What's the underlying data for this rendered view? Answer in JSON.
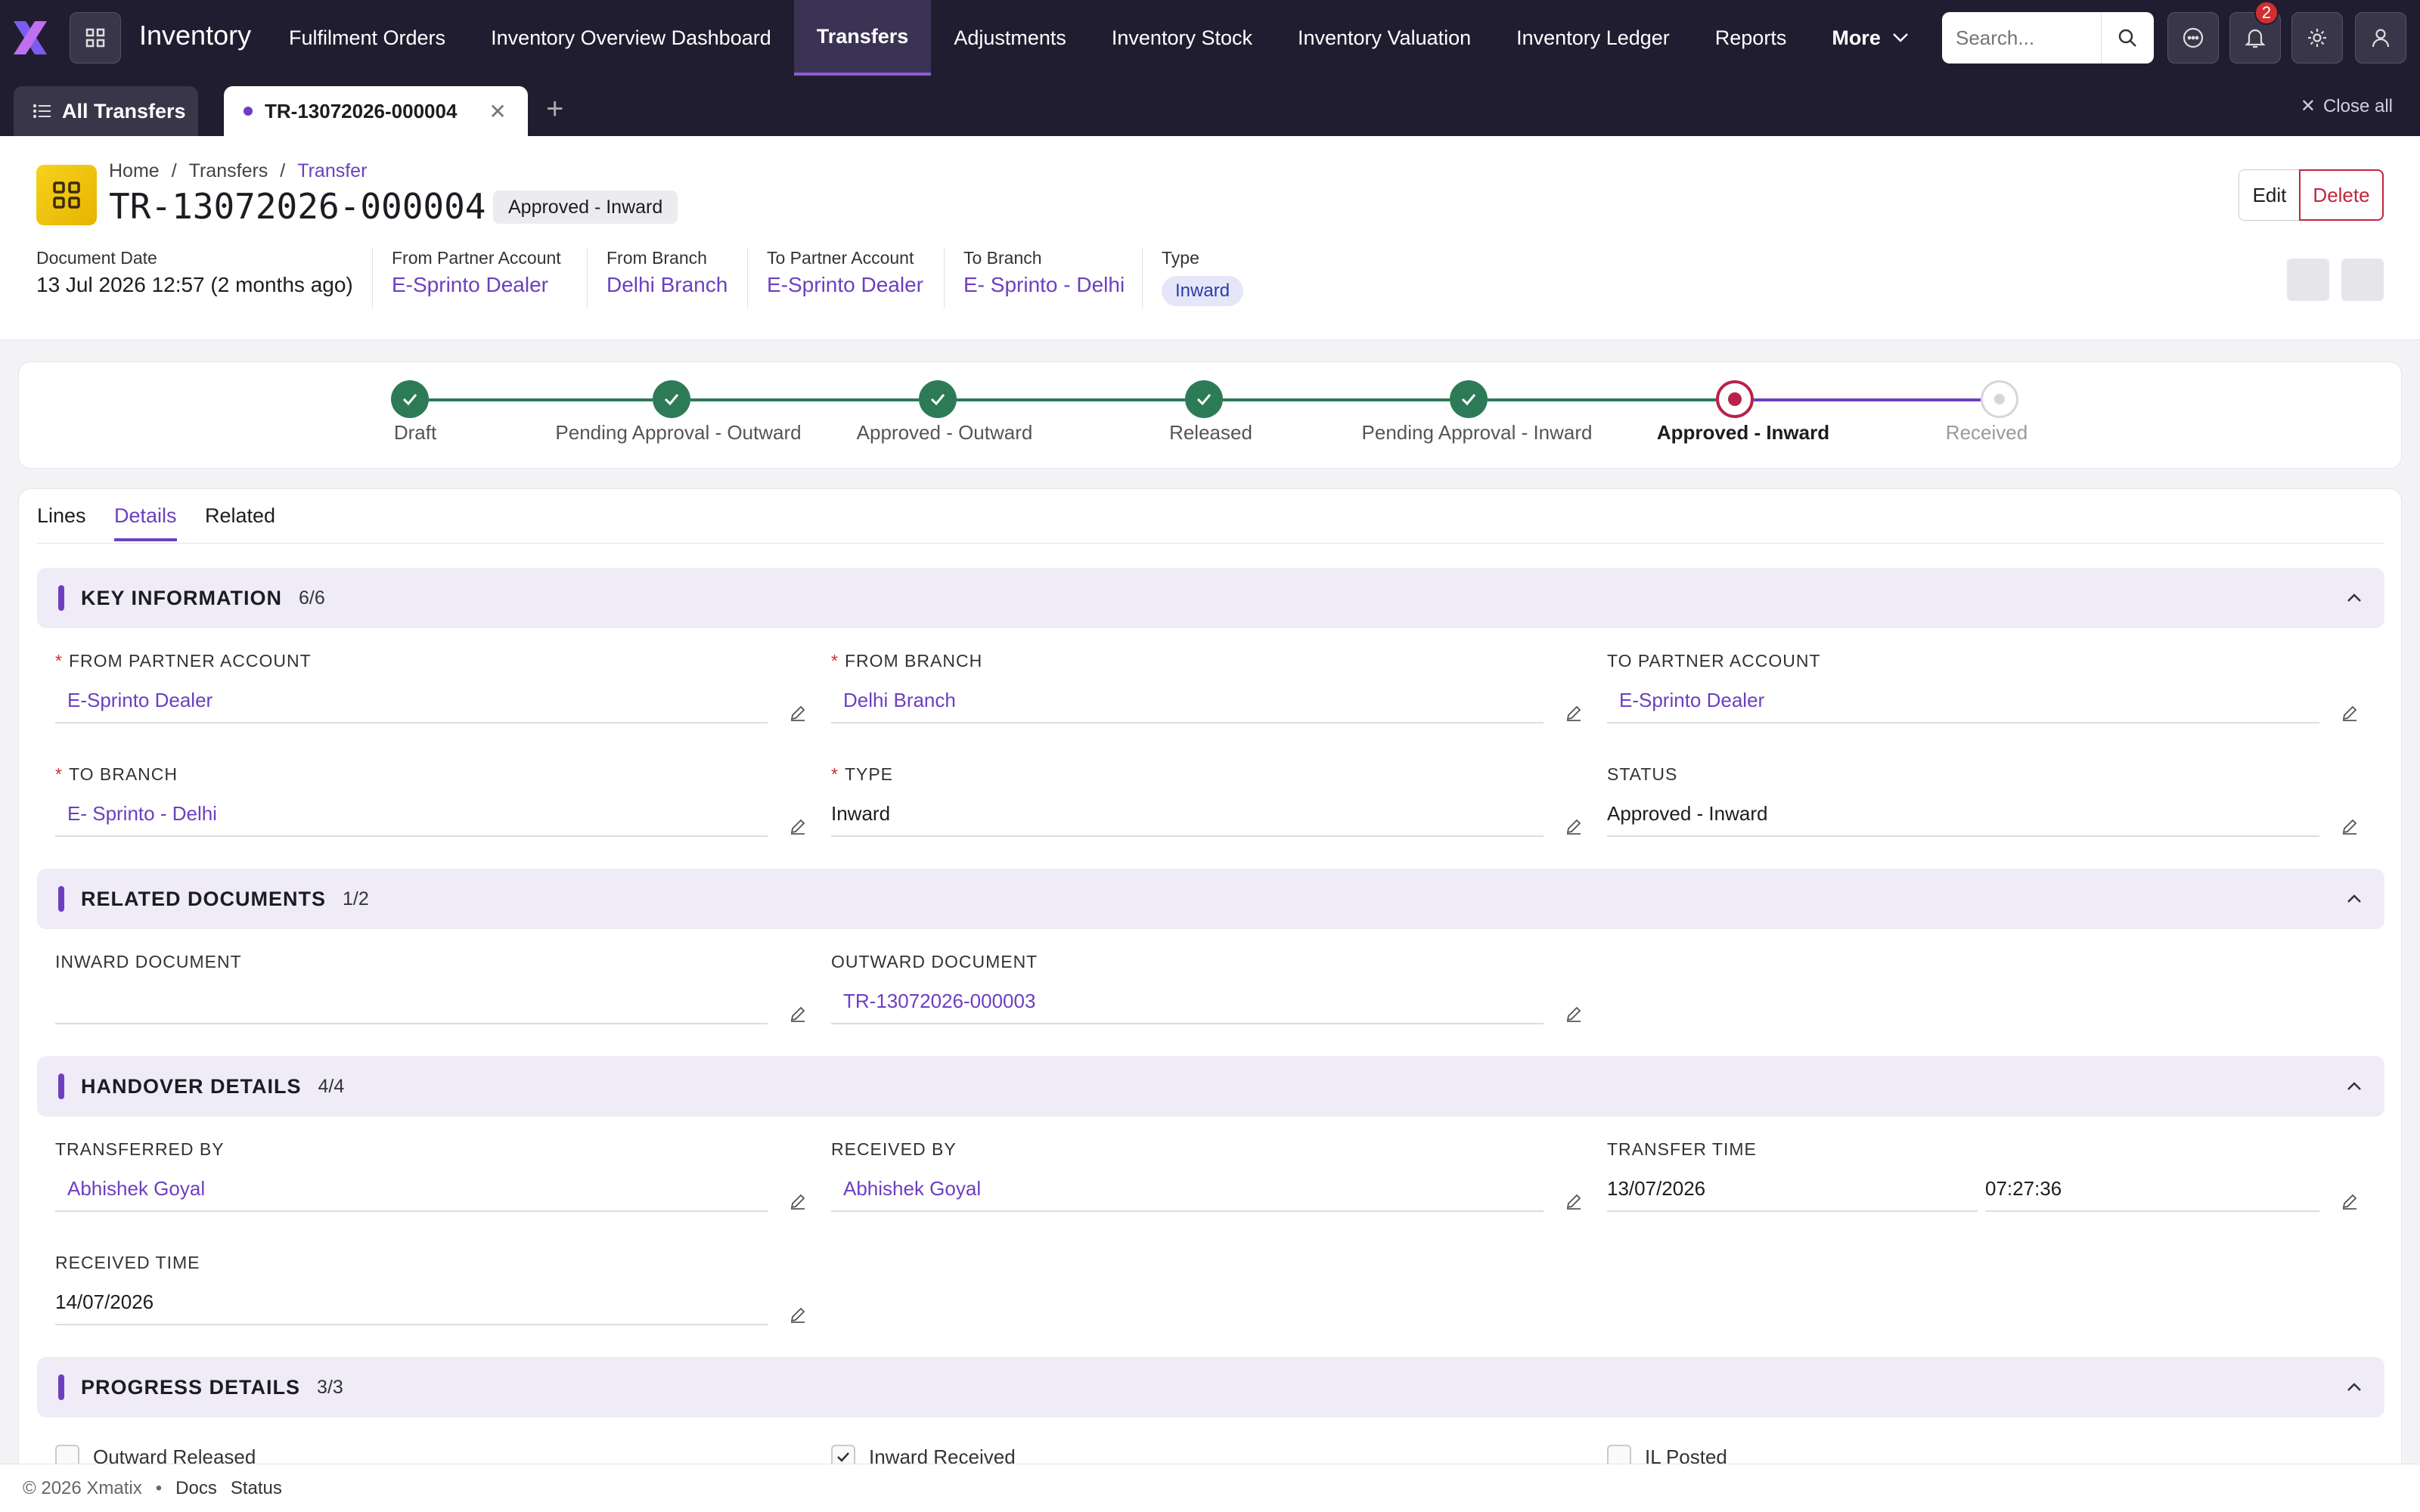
{
  "app": {
    "name": "Inventory"
  },
  "nav": [
    "Fulfilment Orders",
    "Inventory Overview Dashboard",
    "Transfers",
    "Adjustments",
    "Inventory Stock",
    "Inventory Valuation",
    "Inventory Ledger",
    "Reports",
    "More"
  ],
  "nav_active": "Transfers",
  "search": {
    "placeholder": "Search..."
  },
  "notifications": {
    "count": "2"
  },
  "tabs": {
    "all_label": "All Transfers",
    "doc_label": "TR-13072026-000004",
    "close_all": "Close all"
  },
  "breadcrumb": {
    "home": "Home",
    "transfers": "Transfers",
    "current": "Transfer",
    "sep": "/"
  },
  "doc": {
    "title": "TR-13072026-000004",
    "status": "Approved - Inward"
  },
  "actions": {
    "edit": "Edit",
    "delete": "Delete"
  },
  "meta": {
    "document_date_label": "Document Date",
    "document_date": "13 Jul 2026 12:57 (2 months ago)",
    "from_partner_label": "From Partner Account",
    "from_partner": "E-Sprinto Dealer",
    "from_branch_label": "From Branch",
    "from_branch": "Delhi Branch",
    "to_partner_label": "To Partner Account",
    "to_partner": "E-Sprinto Dealer",
    "to_branch_label": "To Branch",
    "to_branch": "E- Sprinto - Delhi",
    "type_label": "Type",
    "type": "Inward"
  },
  "steps": [
    "Draft",
    "Pending Approval - Outward",
    "Approved - Outward",
    "Released",
    "Pending Approval - Inward",
    "Approved - Inward",
    "Received"
  ],
  "current_step": 5,
  "detail_tabs": [
    "Lines",
    "Details",
    "Related"
  ],
  "sections": {
    "key": {
      "title": "KEY INFORMATION",
      "count": "6/6"
    },
    "related": {
      "title": "RELATED DOCUMENTS",
      "count": "1/2"
    },
    "handover": {
      "title": "HANDOVER DETAILS",
      "count": "4/4"
    },
    "progress": {
      "title": "PROGRESS DETAILS",
      "count": "3/3"
    }
  },
  "fields": {
    "from_partner_label": "FROM PARTNER ACCOUNT",
    "from_partner": "E-Sprinto Dealer",
    "from_branch_label": "FROM BRANCH",
    "from_branch": "Delhi Branch",
    "to_partner_label": "TO PARTNER ACCOUNT",
    "to_partner": "E-Sprinto Dealer",
    "to_branch_label": "TO BRANCH",
    "to_branch": "E- Sprinto - Delhi",
    "type_label": "TYPE",
    "type": "Inward",
    "status_label": "STATUS",
    "status": "Approved - Inward",
    "inward_doc_label": "INWARD DOCUMENT",
    "inward_doc": "",
    "outward_doc_label": "OUTWARD DOCUMENT",
    "outward_doc": "TR-13072026-000003",
    "transferred_by_label": "TRANSFERRED BY",
    "transferred_by": "Abhishek Goyal",
    "received_by_label": "RECEIVED BY",
    "received_by": "Abhishek Goyal",
    "transfer_time_label": "TRANSFER TIME",
    "transfer_date": "13/07/2026",
    "transfer_clock": "07:27:36",
    "received_time_label": "RECEIVED TIME",
    "received_time": "14/07/2026"
  },
  "progress": {
    "outward_released": "Outward Released",
    "inward_received": "Inward Received",
    "il_posted": "IL Posted"
  },
  "footer": {
    "copyright": "© 2026 Xmatix",
    "bullet": "•",
    "docs": "Docs",
    "status": "Status"
  },
  "colors": {
    "accent": "#6d3fc0",
    "done": "#2d7a57",
    "current": "#b8224a",
    "topbar": "#211d30"
  }
}
